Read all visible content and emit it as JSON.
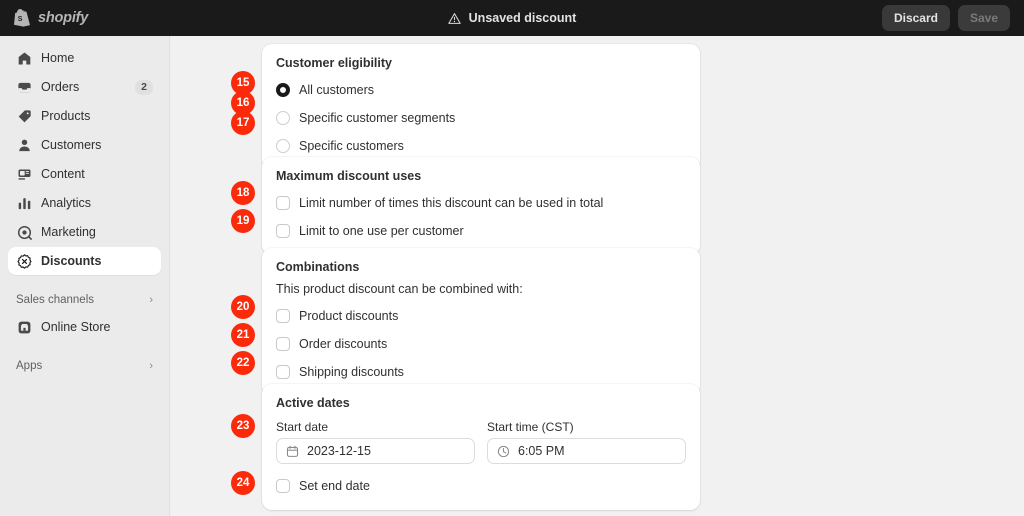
{
  "topbar": {
    "brand_word": "shopify",
    "brand_icon": "shopify-bag-icon",
    "warning_icon": "warning-triangle-icon",
    "unsaved_text": "Unsaved discount",
    "discard_label": "Discard",
    "save_label": "Save",
    "save_disabled": true,
    "bg_color": "#1a1a1a"
  },
  "sidebar": {
    "items": [
      {
        "label": "Home",
        "icon": "home-icon",
        "badge": "",
        "active": false
      },
      {
        "label": "Orders",
        "icon": "orders-icon",
        "badge": "2",
        "active": false
      },
      {
        "label": "Products",
        "icon": "products-icon",
        "badge": "",
        "active": false
      },
      {
        "label": "Customers",
        "icon": "customers-icon",
        "badge": "",
        "active": false
      },
      {
        "label": "Content",
        "icon": "content-icon",
        "badge": "",
        "active": false
      },
      {
        "label": "Analytics",
        "icon": "analytics-icon",
        "badge": "",
        "active": false
      },
      {
        "label": "Marketing",
        "icon": "marketing-icon",
        "badge": "",
        "active": false
      },
      {
        "label": "Discounts",
        "icon": "discounts-icon",
        "badge": "",
        "active": true
      }
    ],
    "sales_channels_label": "Sales channels",
    "online_store_label": "Online Store",
    "online_store_icon": "store-icon",
    "apps_label": "Apps",
    "chevron_icon": "chevron-right-icon"
  },
  "cards": {
    "eligibility": {
      "title": "Customer eligibility",
      "options": [
        {
          "label": "All customers",
          "selected": true,
          "marker": "15"
        },
        {
          "label": "Specific customer segments",
          "selected": false,
          "marker": "16"
        },
        {
          "label": "Specific customers",
          "selected": false,
          "marker": "17"
        }
      ]
    },
    "max_uses": {
      "title": "Maximum discount uses",
      "options": [
        {
          "label": "Limit number of times this discount can be used in total",
          "checked": false,
          "marker": "18"
        },
        {
          "label": "Limit to one use per customer",
          "checked": false,
          "marker": "19"
        }
      ]
    },
    "combinations": {
      "title": "Combinations",
      "subtitle": "This product discount can be combined with:",
      "options": [
        {
          "label": "Product discounts",
          "checked": false,
          "marker": "20"
        },
        {
          "label": "Order discounts",
          "checked": false,
          "marker": "21"
        },
        {
          "label": "Shipping discounts",
          "checked": false,
          "marker": "22"
        }
      ]
    },
    "active_dates": {
      "title": "Active dates",
      "start_date_label": "Start date",
      "start_date_value": "2023-12-15",
      "start_date_icon": "calendar-icon",
      "start_time_label": "Start time (CST)",
      "start_time_value": "6:05 PM",
      "start_time_icon": "clock-icon",
      "set_end_date_label": "Set end date",
      "set_end_date_checked": false,
      "marker_dates": "23",
      "marker_end": "24"
    }
  },
  "colors": {
    "marker_red": "#fa2a0a",
    "page_bg": "#f1f1f1",
    "sidebar_bg": "#ebebeb",
    "card_bg": "#ffffff",
    "text": "#303030"
  }
}
